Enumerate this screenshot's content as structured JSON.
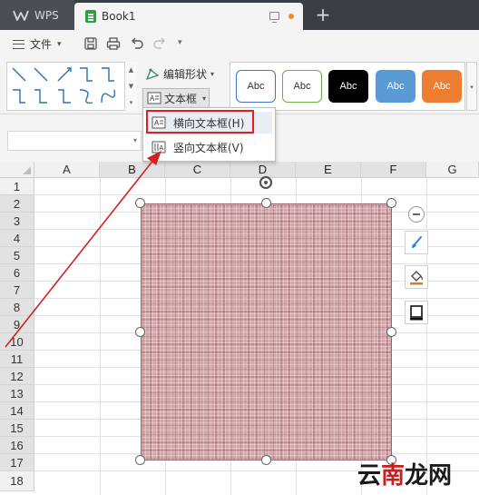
{
  "tabs": {
    "app_label": "WPS",
    "doc_label": "Book1",
    "new_tab": "+"
  },
  "menu": {
    "file_label": "文件",
    "file_caret": "▾",
    "more_caret": "▾"
  },
  "ribbon": {
    "edit_shape_label": "编辑形状",
    "edit_shape_caret": "▾",
    "textbox_label": "文本框",
    "textbox_caret": "▾",
    "gallery_scroll": [
      "▲",
      "▼",
      "▾"
    ],
    "style_scroll": "▾",
    "shape_styles": [
      {
        "label": "Abc",
        "fill": "#ffffff",
        "border": "#4472c4",
        "text": "#333333"
      },
      {
        "label": "Abc",
        "fill": "#ffffff",
        "border": "#70ad47",
        "text": "#333333"
      },
      {
        "label": "Abc",
        "fill": "#000000",
        "border": "#000000",
        "text": "#ffffff"
      },
      {
        "label": "Abc",
        "fill": "#5b9bd5",
        "border": "#5b9bd5",
        "text": "#ffffff"
      },
      {
        "label": "Abc",
        "fill": "#ed7d31",
        "border": "#ed7d31",
        "text": "#ffffff"
      }
    ]
  },
  "formula_bar": {
    "namebox_value": "",
    "namebox_caret": "▾"
  },
  "textbox_menu": {
    "items": [
      {
        "label": "横向文本框(H)",
        "selected": true
      },
      {
        "label": "竖向文本框(V)",
        "selected": false
      }
    ],
    "highlight_color": "#e02020"
  },
  "sheet": {
    "columns": [
      "A",
      "B",
      "C",
      "D",
      "E",
      "F",
      "G"
    ],
    "rows": [
      "1",
      "2",
      "3",
      "4",
      "5",
      "6",
      "7",
      "8",
      "9",
      "10",
      "11",
      "12",
      "13",
      "14",
      "15",
      "16",
      "17",
      "18"
    ]
  },
  "shape": {
    "fill_pattern": "pink-plaid"
  },
  "annotation": {
    "arrow_color": "#d42020"
  },
  "watermark": {
    "chars": [
      "云",
      "南",
      "龙",
      "网"
    ]
  }
}
